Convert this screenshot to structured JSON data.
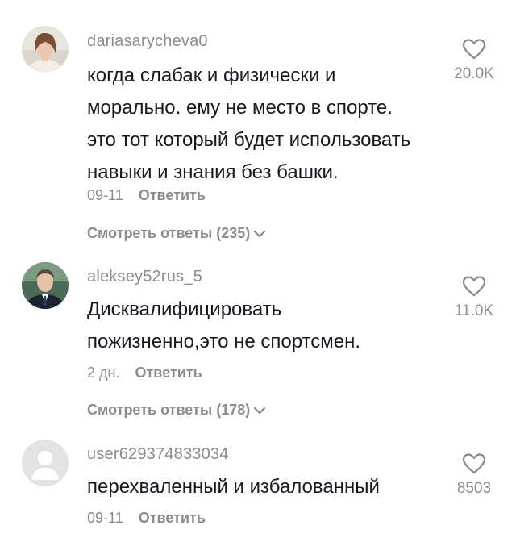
{
  "comments": [
    {
      "username": "dariasarycheva0",
      "text_lines": [
        "когда слабак и физически и",
        "морально. ему не место в спорте.",
        "это тот который будет использовать",
        "навыки и знания без башки."
      ],
      "date": "09-11",
      "reply_label": "Ответить",
      "view_replies_label": "Смотреть ответы (235)",
      "likes": "20.0K",
      "avatar_icon": "woman-portrait"
    },
    {
      "username": "aleksey52rus_5",
      "text_lines": [
        "Дисквалифицировать",
        "пожизненно,это не спортсмен."
      ],
      "date": "2 дн.",
      "reply_label": "Ответить",
      "view_replies_label": "Смотреть ответы (178)",
      "likes": "11.0K",
      "avatar_icon": "man-in-suit-portrait"
    },
    {
      "username": "user629374833034",
      "text_lines": [
        "перехваленный и избалованный"
      ],
      "date": "09-11",
      "reply_label": "Ответить",
      "likes": "8503",
      "avatar_icon": "default-user-avatar"
    }
  ],
  "icons": {
    "like": "heart-outline-icon",
    "expand": "chevron-down-icon"
  },
  "colors": {
    "primary_text": "#161823",
    "secondary_text": "#8a8b91",
    "background": "#ffffff"
  }
}
